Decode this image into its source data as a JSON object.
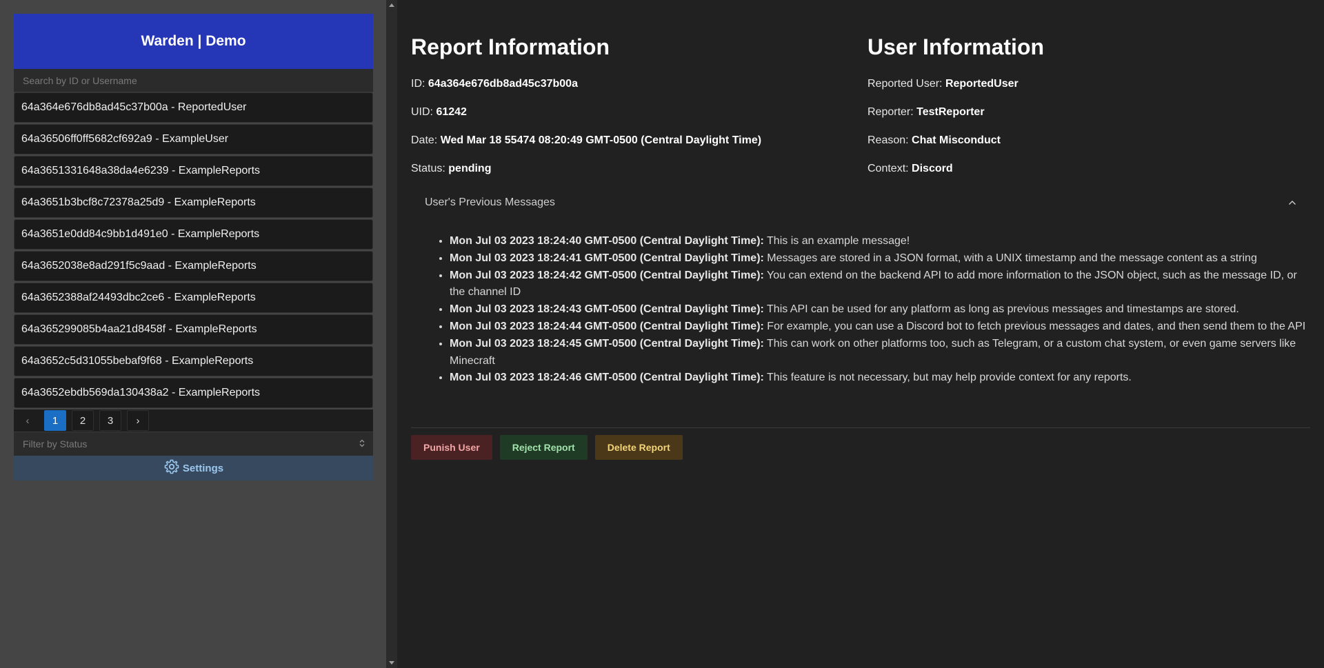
{
  "sidebar": {
    "brand": "Warden | Demo",
    "search_placeholder": "Search by ID or Username",
    "reports": [
      "64a364e676db8ad45c37b00a - ReportedUser",
      "64a36506ff0ff5682cf692a9 - ExampleUser",
      "64a3651331648a38da4e6239 - ExampleReports",
      "64a3651b3bcf8c72378a25d9 - ExampleReports",
      "64a3651e0dd84c9bb1d491e0 - ExampleReports",
      "64a3652038e8ad291f5c9aad - ExampleReports",
      "64a3652388af24493dbc2ce6 - ExampleReports",
      "64a365299085b4aa21d8458f - ExampleReports",
      "64a3652c5d31055bebaf9f68 - ExampleReports",
      "64a3652ebdb569da130438a2 - ExampleReports"
    ],
    "pagination": {
      "prev": "‹",
      "pages": [
        "1",
        "2",
        "3"
      ],
      "current": "1",
      "next": "›"
    },
    "filter_placeholder": "Filter by Status",
    "settings_label": "Settings"
  },
  "report_info": {
    "title": "Report Information",
    "id_label": "ID:",
    "id": "64a364e676db8ad45c37b00a",
    "uid_label": "UID:",
    "uid": "61242",
    "date_label": "Date:",
    "date": "Wed Mar 18 55474 08:20:49 GMT-0500 (Central Daylight Time)",
    "status_label": "Status:",
    "status": "pending"
  },
  "user_info": {
    "title": "User Information",
    "reported_label": "Reported User:",
    "reported": "ReportedUser",
    "reporter_label": "Reporter:",
    "reporter": "TestReporter",
    "reason_label": "Reason:",
    "reason": "Chat Misconduct",
    "context_label": "Context:",
    "context": "Discord"
  },
  "previous_messages": {
    "title": "User's Previous Messages",
    "items": [
      {
        "time": "Mon Jul 03 2023 18:24:40 GMT-0500 (Central Daylight Time):",
        "text": " This is an example message!"
      },
      {
        "time": "Mon Jul 03 2023 18:24:41 GMT-0500 (Central Daylight Time):",
        "text": " Messages are stored in a JSON format, with a UNIX timestamp and the message content as a string"
      },
      {
        "time": "Mon Jul 03 2023 18:24:42 GMT-0500 (Central Daylight Time):",
        "text": " You can extend on the backend API to add more information to the JSON object, such as the message ID, or the channel ID"
      },
      {
        "time": "Mon Jul 03 2023 18:24:43 GMT-0500 (Central Daylight Time):",
        "text": " This API can be used for any platform as long as previous messages and timestamps are stored."
      },
      {
        "time": "Mon Jul 03 2023 18:24:44 GMT-0500 (Central Daylight Time):",
        "text": " For example, you can use a Discord bot to fetch previous messages and dates, and then send them to the API"
      },
      {
        "time": "Mon Jul 03 2023 18:24:45 GMT-0500 (Central Daylight Time):",
        "text": " This can work on other platforms too, such as Telegram, or a custom chat system, or even game servers like Minecraft"
      },
      {
        "time": "Mon Jul 03 2023 18:24:46 GMT-0500 (Central Daylight Time):",
        "text": " This feature is not necessary, but may help provide context for any reports."
      }
    ]
  },
  "actions": {
    "punish": "Punish User",
    "reject": "Reject Report",
    "delete": "Delete Report"
  },
  "colors": {
    "brand": "#2536b7",
    "active_page": "#1a6fc4",
    "punish": "#4a2224",
    "reject": "#1f3b25",
    "delete": "#4a3819"
  }
}
